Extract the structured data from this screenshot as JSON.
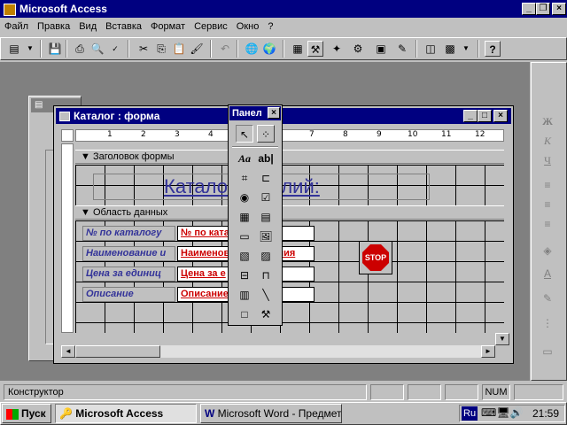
{
  "app": {
    "title": "Microsoft Access"
  },
  "menu": [
    "Файл",
    "Правка",
    "Вид",
    "Вставка",
    "Формат",
    "Сервис",
    "Окно",
    "?"
  ],
  "toolbar": {
    "icons": [
      "form-view-icon",
      "save-icon",
      "print-icon",
      "print-preview-icon",
      "spelling-icon",
      "cut-icon",
      "copy-icon",
      "paste-icon",
      "format-painter-icon",
      "undo-icon",
      "insert-hyperlink-icon",
      "web-toolbar-icon",
      "field-list-icon",
      "toolbox-icon",
      "autoformat-icon",
      "code-icon",
      "properties-icon",
      "build-icon",
      "database-window-icon",
      "new-object-icon",
      "help-icon"
    ]
  },
  "form_window": {
    "title": "Каталог : форма",
    "ruler": [
      "1",
      "2",
      "3",
      "4",
      "5",
      "6",
      "7",
      "8",
      "9",
      "10",
      "11",
      "12"
    ],
    "header_section": "Заголовок формы",
    "header_title": "Каталог изделий:",
    "detail_section": "Область данных",
    "labels": [
      "№ по каталогу",
      "Наименование и",
      "Цена за единиц",
      "Описание"
    ],
    "fields": [
      "№ по ката",
      "Наименование изделия",
      "Цена за е",
      "Описание"
    ],
    "stop_label": "STOP"
  },
  "toolbox": {
    "title": "Панел"
  },
  "status_bar": {
    "text": "Конструктор",
    "num": "NUM"
  },
  "taskbar": {
    "start": "Пуск",
    "tasks": [
      "Microsoft Access",
      "Microsoft Word - Предмет..."
    ],
    "lang": "Ru",
    "clock": "21:59"
  }
}
